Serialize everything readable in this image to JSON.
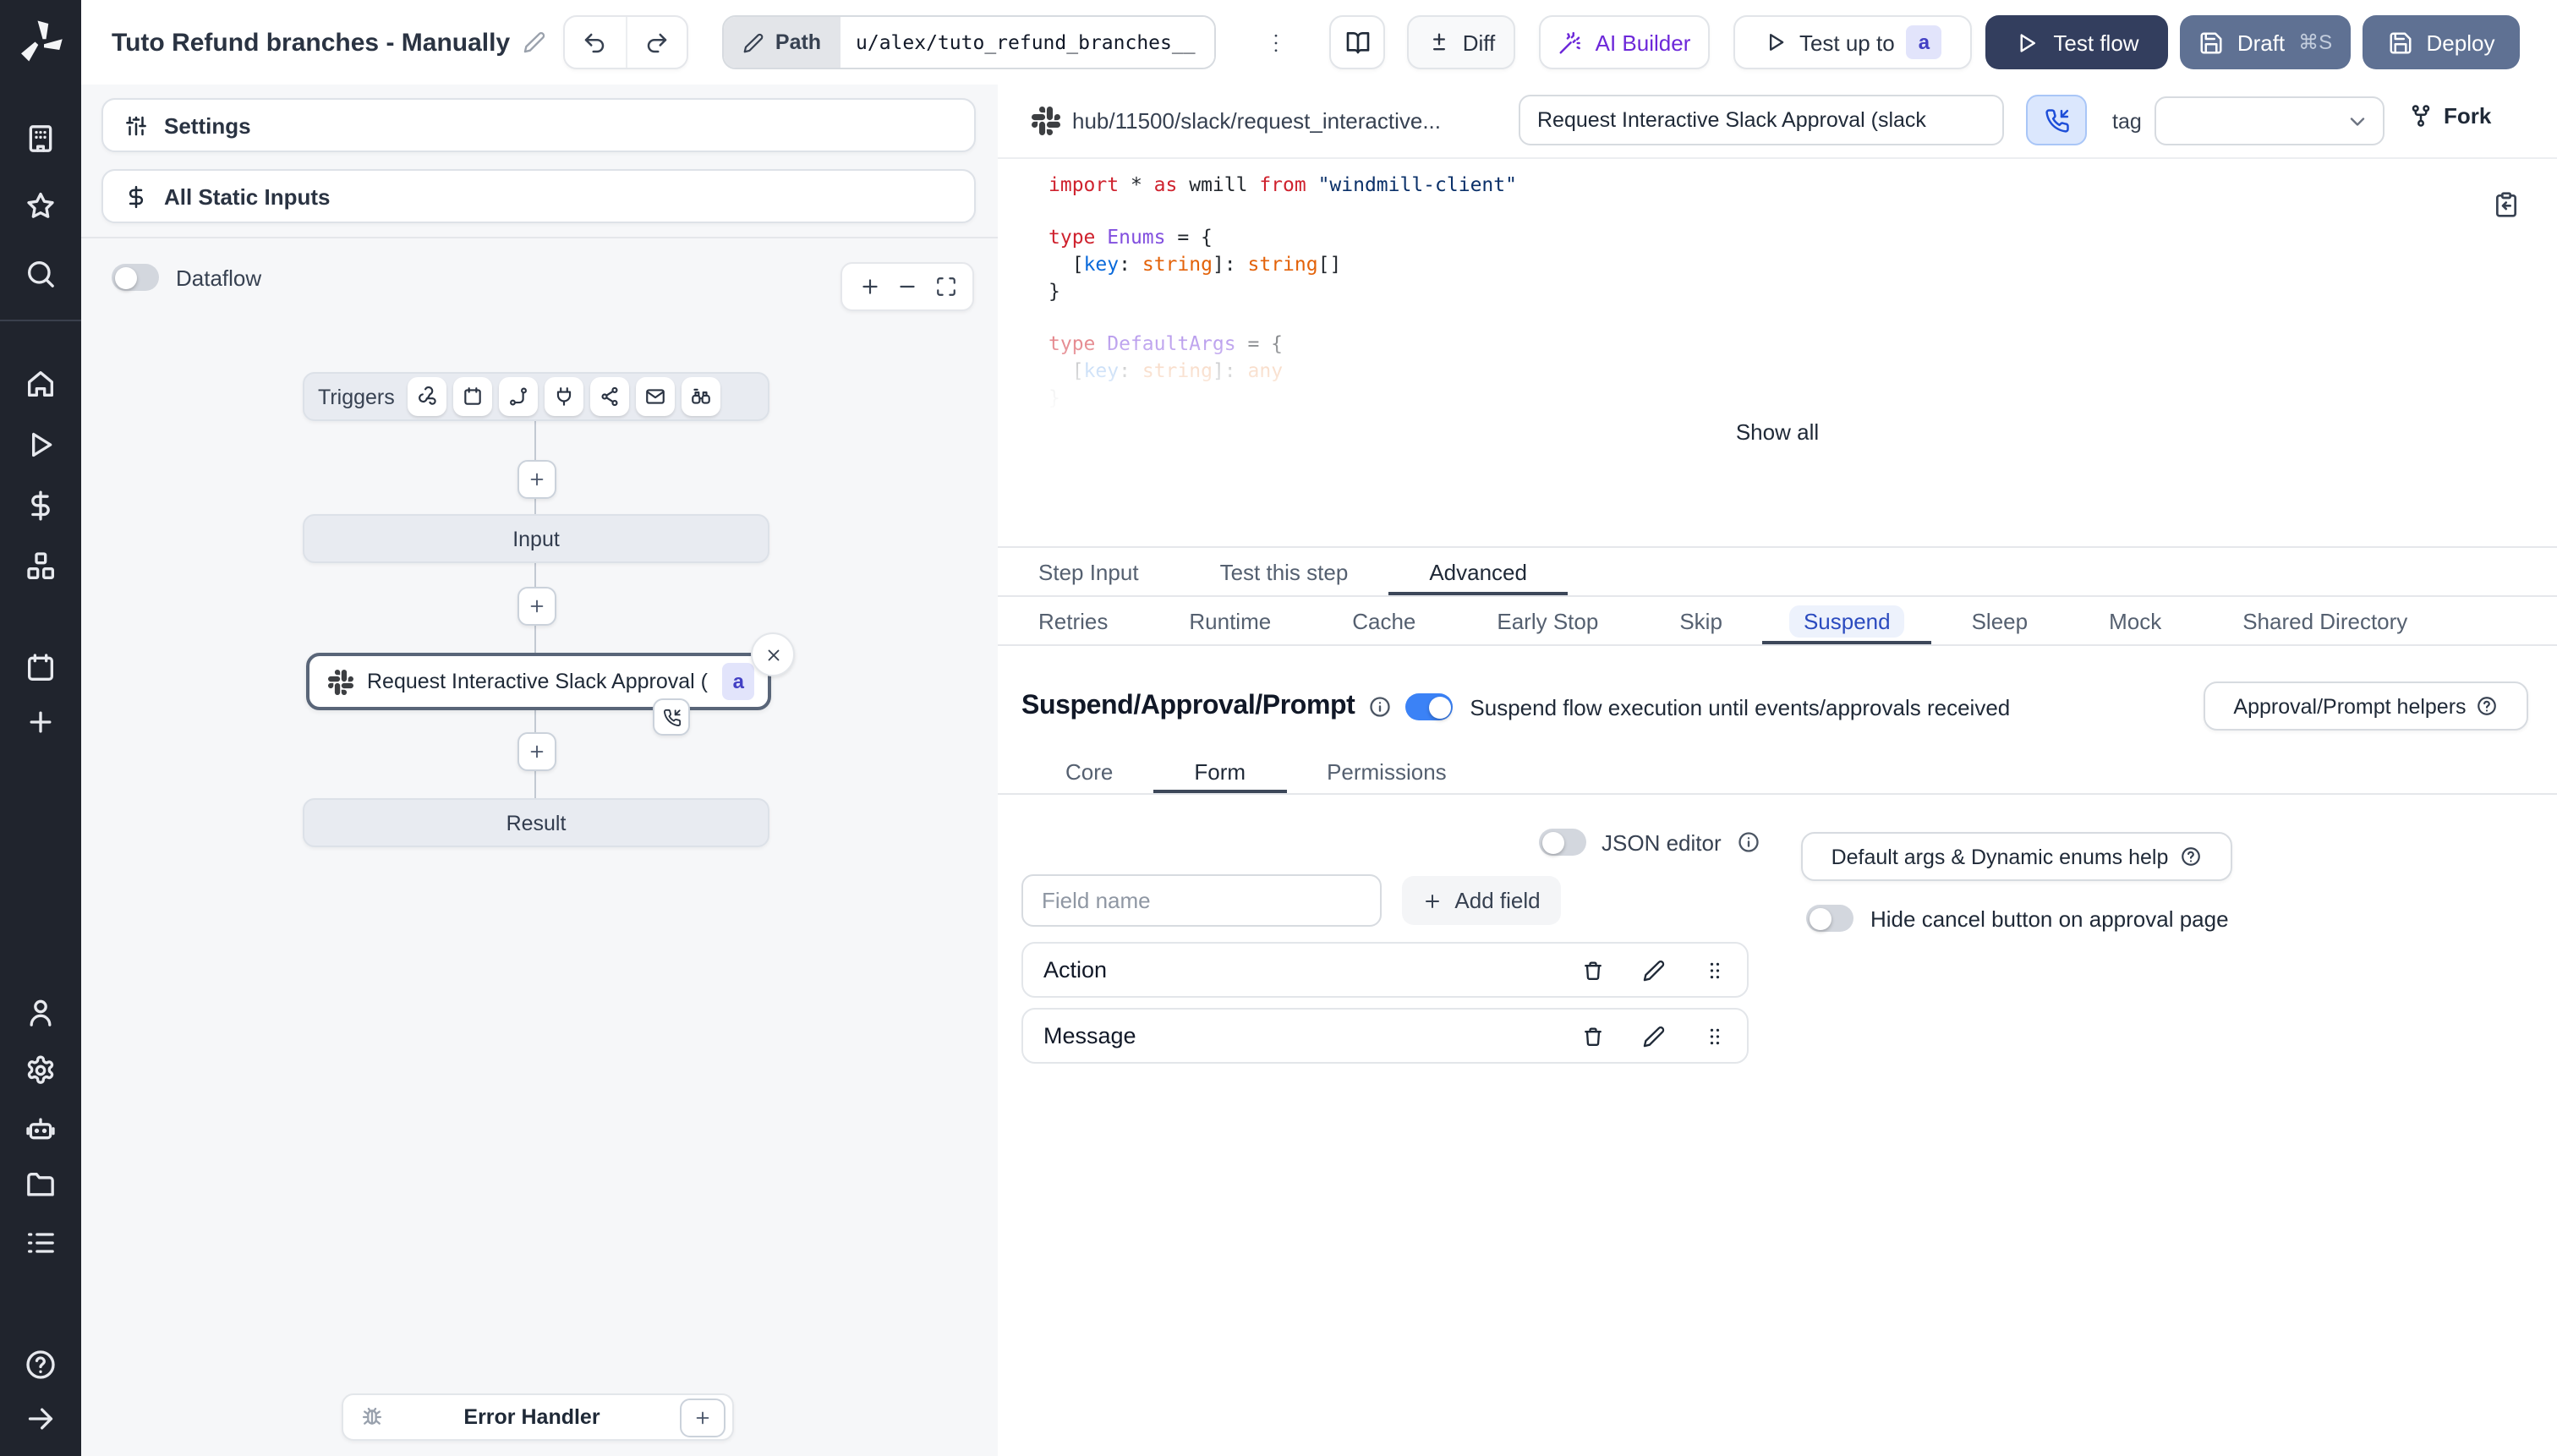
{
  "topbar": {
    "title": "Tuto Refund branches - Manually",
    "path_label": "Path",
    "path_value": "u/alex/tuto_refund_branches__",
    "diff_label": "Diff",
    "ai_builder_label": "AI Builder",
    "test_up_to_label": "Test up to",
    "test_up_to_badge": "a",
    "test_flow_label": "Test flow",
    "draft_label": "Draft",
    "draft_shortcut": "⌘S",
    "deploy_label": "Deploy"
  },
  "sidebar": {
    "top_icons": [
      "workspace",
      "favorites",
      "search"
    ],
    "mid_icons": [
      "home",
      "runs",
      "variables",
      "resources",
      "schedules",
      "add"
    ],
    "bottom_icons": [
      "user",
      "settings",
      "workers",
      "folders",
      "logs"
    ],
    "footer_icons": [
      "help",
      "expand"
    ]
  },
  "flow_panel": {
    "settings_label": "Settings",
    "all_static_inputs_label": "All Static Inputs",
    "dataflow_label": "Dataflow",
    "graph": {
      "triggers_label": "Triggers",
      "trigger_icons": [
        "webhook",
        "schedule",
        "http-route",
        "websocket",
        "kafka",
        "email",
        "poll"
      ],
      "input_label": "Input",
      "step_label": "Request Interactive Slack Approval (...",
      "step_badge": "a",
      "result_label": "Result",
      "error_handler_label": "Error Handler"
    }
  },
  "editor": {
    "hub_path": "hub/11500/slack/request_interactive...",
    "summary_value": "Request Interactive Slack Approval (slack",
    "tag_label": "tag",
    "fork_label": "Fork",
    "show_all_label": "Show all",
    "code_lines": [
      {
        "fade": 1,
        "tokens": [
          [
            "import ",
            "kw"
          ],
          [
            "* ",
            "pl"
          ],
          [
            "as ",
            "kw"
          ],
          [
            "wmill ",
            "pl"
          ],
          [
            "from ",
            "kw"
          ],
          [
            "\"windmill-client\"",
            "str"
          ]
        ]
      },
      {
        "fade": 1,
        "tokens": []
      },
      {
        "fade": 1,
        "tokens": [
          [
            "type ",
            "kw"
          ],
          [
            "Enums",
            "type"
          ],
          [
            " = {",
            "pl"
          ]
        ]
      },
      {
        "fade": 1,
        "tokens": [
          [
            "  [",
            "pl"
          ],
          [
            "key",
            "prop"
          ],
          [
            ": ",
            "pl"
          ],
          [
            "string",
            "num"
          ],
          [
            "]: ",
            "pl"
          ],
          [
            "string",
            "num"
          ],
          [
            "[]",
            "pl"
          ]
        ]
      },
      {
        "fade": 1,
        "tokens": [
          [
            "}",
            "pl"
          ]
        ]
      },
      {
        "fade": 1,
        "tokens": []
      },
      {
        "fade": 0.55,
        "tokens": [
          [
            "type ",
            "kw"
          ],
          [
            "DefaultArgs",
            "type"
          ],
          [
            " = {",
            "pl"
          ]
        ]
      },
      {
        "fade": 0.32,
        "tokens": [
          [
            "  [",
            "pl"
          ],
          [
            "key",
            "prop"
          ],
          [
            ": ",
            "pl"
          ],
          [
            "string",
            "num"
          ],
          [
            "]: ",
            "pl"
          ],
          [
            "any",
            "num"
          ]
        ]
      },
      {
        "fade": 0.14,
        "tokens": [
          [
            "}",
            "pl"
          ]
        ]
      }
    ],
    "tabs": [
      "Step Input",
      "Test this step",
      "Advanced"
    ],
    "active_tab": 2,
    "subtabs": [
      "Retries",
      "Runtime",
      "Cache",
      "Early Stop",
      "Skip",
      "Suspend",
      "Sleep",
      "Mock",
      "Shared Directory"
    ],
    "active_subtab": 5
  },
  "suspend": {
    "heading": "Suspend/Approval/Prompt",
    "toggle_description": "Suspend flow execution until events/approvals received",
    "helpers_label": "Approval/Prompt helpers",
    "tabs": [
      "Core",
      "Form",
      "Permissions"
    ],
    "active_tab": 1,
    "json_editor_label": "JSON editor",
    "field_name_placeholder": "Field name",
    "add_field_label": "Add field",
    "fields": [
      "Action",
      "Message"
    ],
    "default_args_help_label": "Default args & Dynamic enums help",
    "hide_cancel_label": "Hide cancel button on approval page"
  },
  "ui_colors": {
    "accent_blue": "#3b82f6",
    "primary_button": "#333e5e",
    "secondary_button": "#5f7193",
    "sidebar_bg": "#20242d",
    "badge_bg": "#e2e4fb",
    "badge_text": "#4340c4",
    "active_subtab_text": "#2b4bbf"
  }
}
